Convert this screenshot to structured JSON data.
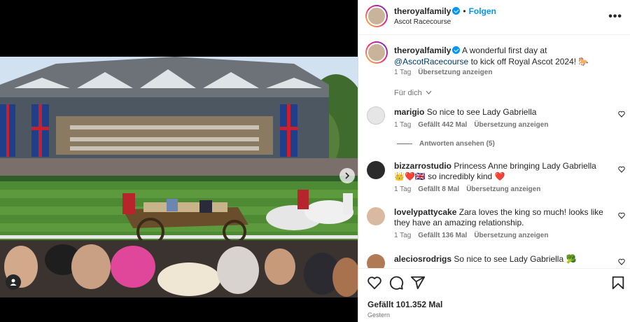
{
  "post": {
    "author": "theroyalfamily",
    "follow_label": "Folgen",
    "location": "Ascot Racecourse",
    "caption_prefix": "A wonderful first day at ",
    "caption_mention": "@AscotRacecourse",
    "caption_suffix": " to kick off Royal Ascot 2024! 🐎",
    "time": "1 Tag",
    "translate": "Übersetzung anzeigen",
    "for_you": "Für dich"
  },
  "comments": [
    {
      "user": "marigio",
      "text": "So nice to see Lady Gabriella",
      "time": "1 Tag",
      "likes": "Gefällt 442 Mal",
      "translate": "Übersetzung anzeigen",
      "replies": "Antworten ansehen (5)"
    },
    {
      "user": "bizzarrostudio",
      "text": "Princess Anne bringing Lady Gabriella 👑❤️🇬🇧 so incredibly kind ❤️",
      "time": "1 Tag",
      "likes": "Gefällt 8 Mal",
      "translate": "Übersetzung anzeigen"
    },
    {
      "user": "lovelypattycake",
      "text": "Zara loves the king so much! looks like they have an amazing relationship.",
      "time": "1 Tag",
      "likes": "Gefällt 136 Mal",
      "translate": "Übersetzung anzeigen"
    },
    {
      "user": "aleciosrodrigs",
      "text": "So nice to see Lady Gabriella 🥦"
    }
  ],
  "footer": {
    "likes": "Gefällt 101.352 Mal",
    "date": "Gestern"
  },
  "icons": {
    "actions": [
      "heart-icon",
      "comment-icon",
      "share-icon",
      "bookmark-icon"
    ],
    "more": "more-options-icon"
  },
  "colors": {
    "accent": "#0095f6",
    "mention": "#00376b",
    "muted": "#737373"
  }
}
